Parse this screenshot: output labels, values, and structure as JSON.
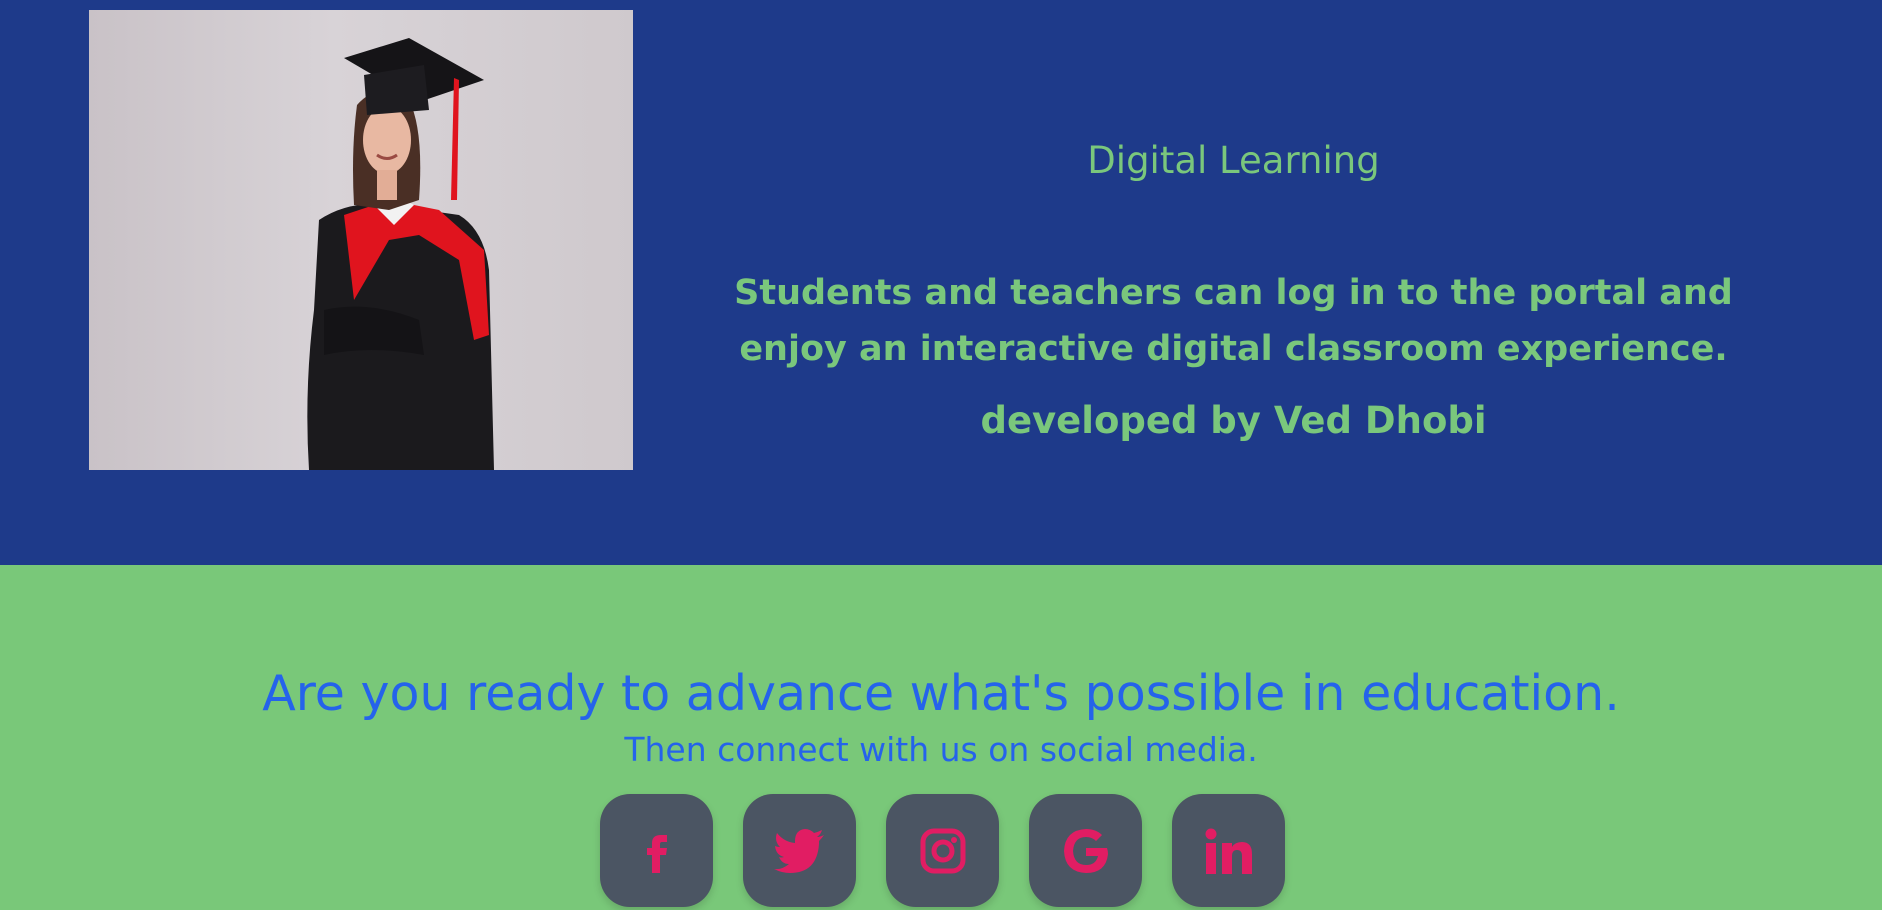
{
  "hero": {
    "title": "Digital Learning",
    "description": "Students and teachers can log in to the portal and enjoy an interactive digital classroom experience.",
    "developed_by_label": "developed by",
    "developer_name": "Ved Dhobi",
    "image_icon": "graduate-photo"
  },
  "cta": {
    "headline": "Are you ready to advance what's possible in education.",
    "subtitle": "Then connect with us on social media."
  },
  "social": [
    {
      "icon": "facebook-icon"
    },
    {
      "icon": "twitter-icon"
    },
    {
      "icon": "instagram-icon"
    },
    {
      "icon": "google-icon"
    },
    {
      "icon": "linkedin-icon"
    }
  ],
  "colors": {
    "hero_background": "#1e3a8a",
    "hero_text": "#7ac77c",
    "cta_background": "#79c879",
    "cta_text": "#2563eb",
    "social_button": "#4b5563",
    "social_icon": "#e11d63"
  }
}
